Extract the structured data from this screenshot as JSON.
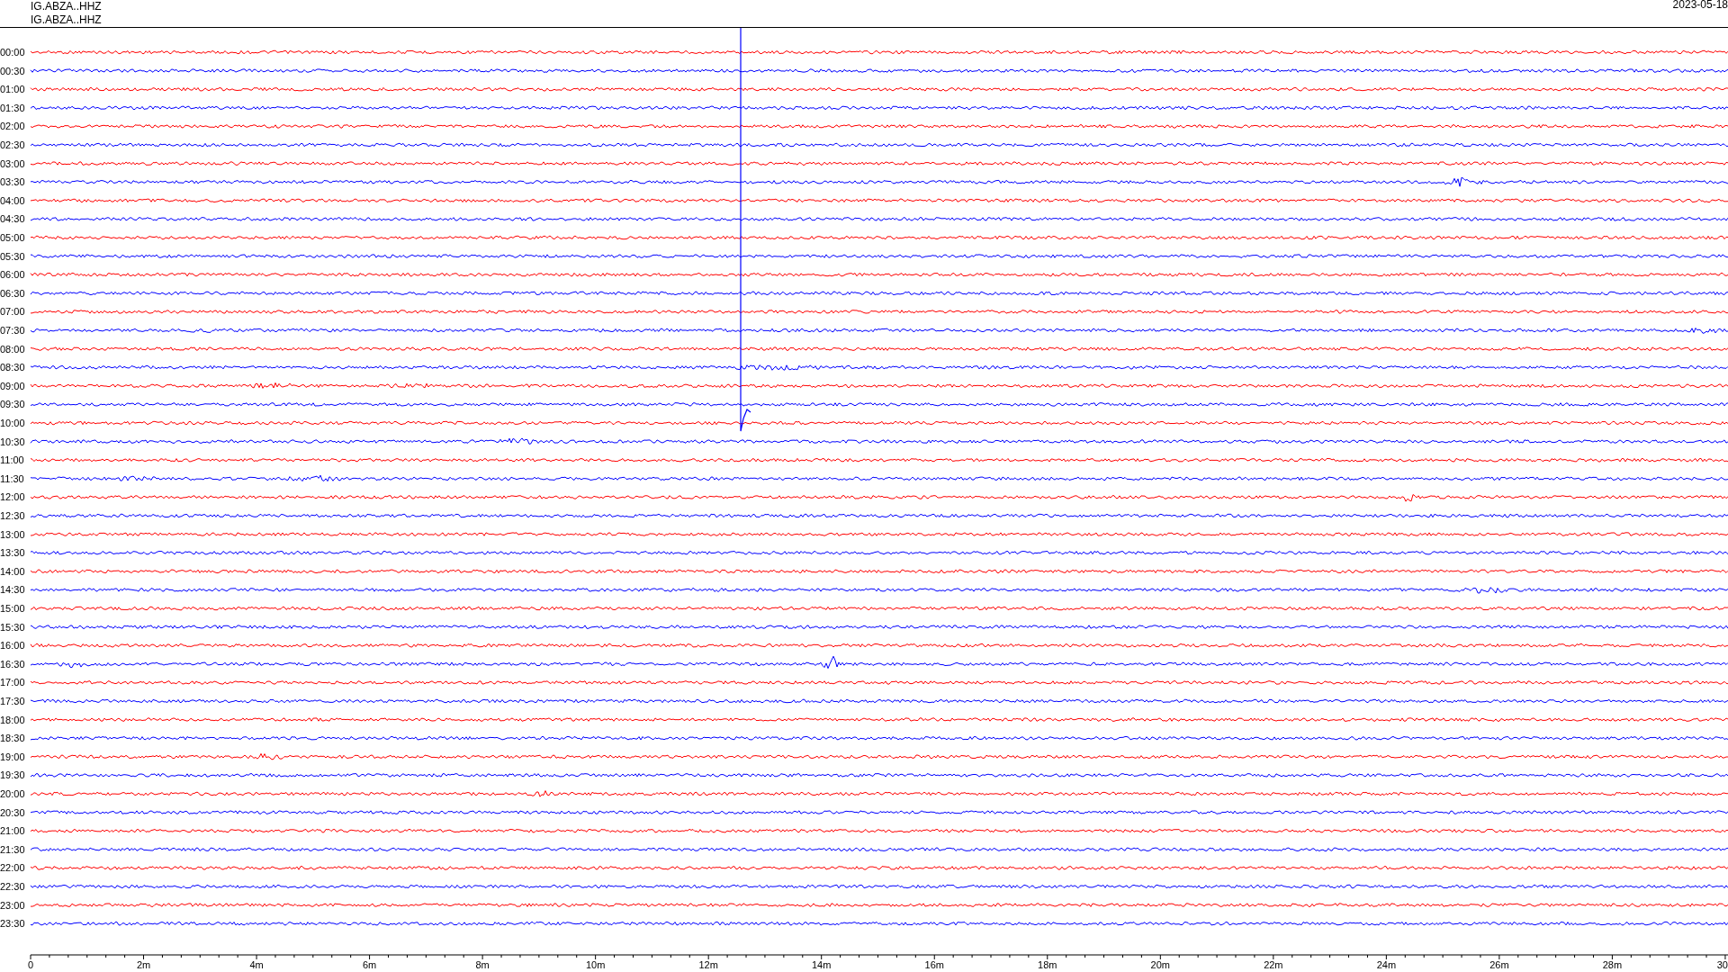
{
  "header": {
    "station_lines": [
      "IG.ABZA..HHZ",
      "IG.ABZA..HHZ"
    ],
    "date": "2023-05-18"
  },
  "rows": [
    {
      "label": "00:00",
      "color": "#ff0000"
    },
    {
      "label": "00:30",
      "color": "#0000ff"
    },
    {
      "label": "01:00",
      "color": "#ff0000"
    },
    {
      "label": "01:30",
      "color": "#0000ff"
    },
    {
      "label": "02:00",
      "color": "#ff0000"
    },
    {
      "label": "02:30",
      "color": "#0000ff"
    },
    {
      "label": "03:00",
      "color": "#ff0000"
    },
    {
      "label": "03:30",
      "color": "#0000ff"
    },
    {
      "label": "04:00",
      "color": "#ff0000"
    },
    {
      "label": "04:30",
      "color": "#0000ff"
    },
    {
      "label": "05:00",
      "color": "#ff0000"
    },
    {
      "label": "05:30",
      "color": "#0000ff"
    },
    {
      "label": "06:00",
      "color": "#ff0000"
    },
    {
      "label": "06:30",
      "color": "#0000ff"
    },
    {
      "label": "07:00",
      "color": "#ff0000"
    },
    {
      "label": "07:30",
      "color": "#0000ff"
    },
    {
      "label": "08:00",
      "color": "#ff0000"
    },
    {
      "label": "08:30",
      "color": "#0000ff"
    },
    {
      "label": "09:00",
      "color": "#ff0000"
    },
    {
      "label": "09:30",
      "color": "#0000ff"
    },
    {
      "label": "10:00",
      "color": "#ff0000"
    },
    {
      "label": "10:30",
      "color": "#0000ff"
    },
    {
      "label": "11:00",
      "color": "#ff0000"
    },
    {
      "label": "11:30",
      "color": "#0000ff"
    },
    {
      "label": "12:00",
      "color": "#ff0000"
    },
    {
      "label": "12:30",
      "color": "#0000ff"
    },
    {
      "label": "13:00",
      "color": "#ff0000"
    },
    {
      "label": "13:30",
      "color": "#0000ff"
    },
    {
      "label": "14:00",
      "color": "#ff0000"
    },
    {
      "label": "14:30",
      "color": "#0000ff"
    },
    {
      "label": "15:00",
      "color": "#ff0000"
    },
    {
      "label": "15:30",
      "color": "#0000ff"
    },
    {
      "label": "16:00",
      "color": "#ff0000"
    },
    {
      "label": "16:30",
      "color": "#0000ff"
    },
    {
      "label": "17:00",
      "color": "#ff0000"
    },
    {
      "label": "17:30",
      "color": "#0000ff"
    },
    {
      "label": "18:00",
      "color": "#ff0000"
    },
    {
      "label": "18:30",
      "color": "#0000ff"
    },
    {
      "label": "19:00",
      "color": "#ff0000"
    },
    {
      "label": "19:30",
      "color": "#0000ff"
    },
    {
      "label": "20:00",
      "color": "#ff0000"
    },
    {
      "label": "20:30",
      "color": "#0000ff"
    },
    {
      "label": "21:00",
      "color": "#ff0000"
    },
    {
      "label": "21:30",
      "color": "#0000ff"
    },
    {
      "label": "22:00",
      "color": "#ff0000"
    },
    {
      "label": "22:30",
      "color": "#0000ff"
    },
    {
      "label": "23:00",
      "color": "#ff0000"
    },
    {
      "label": "23:30",
      "color": "#0000ff"
    }
  ],
  "x_axis": {
    "labels": [
      "0",
      "2m",
      "4m",
      "6m",
      "8m",
      "10m",
      "12m",
      "14m",
      "16m",
      "18m",
      "20m",
      "22m",
      "24m",
      "26m",
      "28m",
      "30"
    ]
  }
}
